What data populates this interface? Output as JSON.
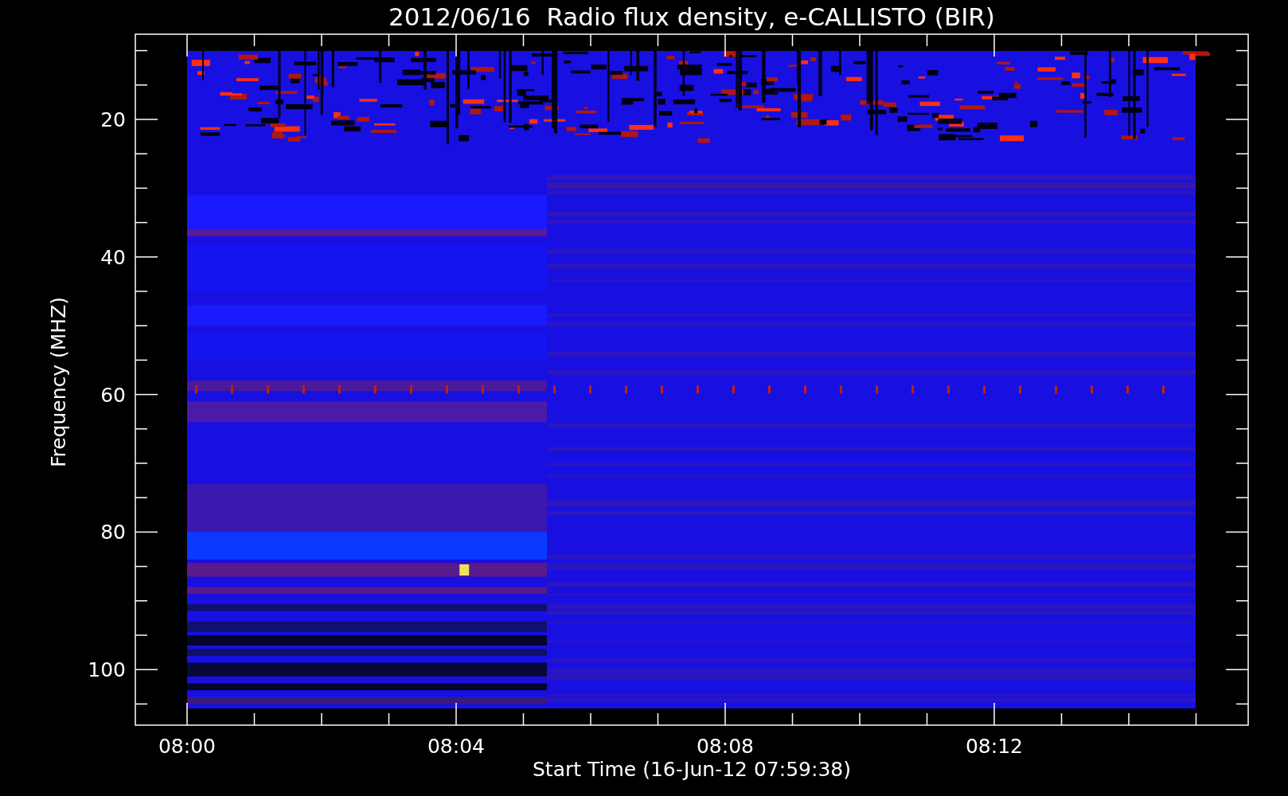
{
  "title": "2012/06/16  Radio flux density, e-CALLISTO (BIR)",
  "ylabel": "Frequency (MHZ)",
  "xlabel": "Start Time (16-Jun-12 07:59:38)",
  "yticks": [
    "20",
    "40",
    "60",
    "80",
    "100"
  ],
  "xticks": [
    "08:00",
    "08:04",
    "08:08",
    "08:12"
  ]
}
